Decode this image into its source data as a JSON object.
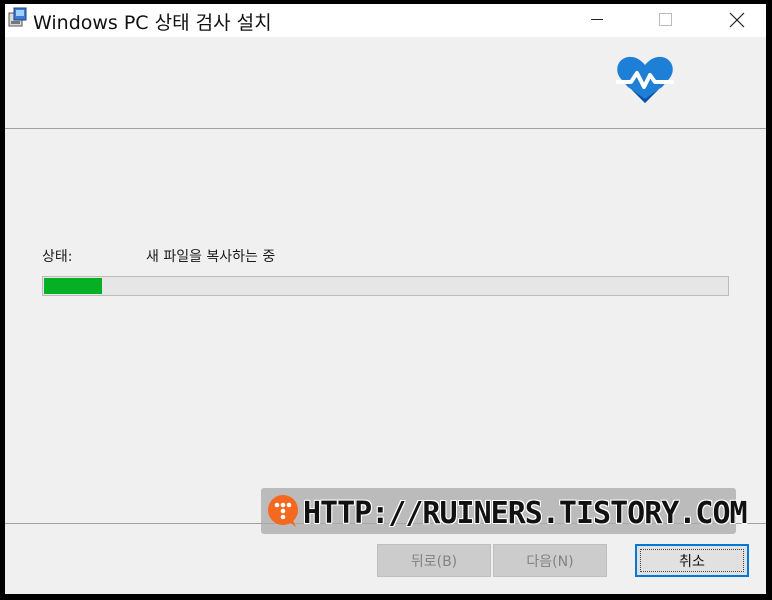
{
  "window": {
    "title": "Windows PC 상태 검사 설치",
    "controls": {
      "minimize": "minimize-icon",
      "maximize": "maximize-icon",
      "close": "close-icon"
    }
  },
  "header": {
    "icon": "heart-pulse-icon",
    "icon_color": "#1e7fd6"
  },
  "status": {
    "label": "상태:",
    "value": "새 파일을 복사하는 중"
  },
  "progress": {
    "fraction": 0.085,
    "fill_color": "#06b025"
  },
  "buttons": {
    "back_label": "뒤로(B)",
    "next_label": "다음(N)",
    "cancel_label": "취소"
  },
  "watermark": {
    "text": "HTTP://RUINERS.TISTORY.COM",
    "logo_color": "#f4681f"
  }
}
